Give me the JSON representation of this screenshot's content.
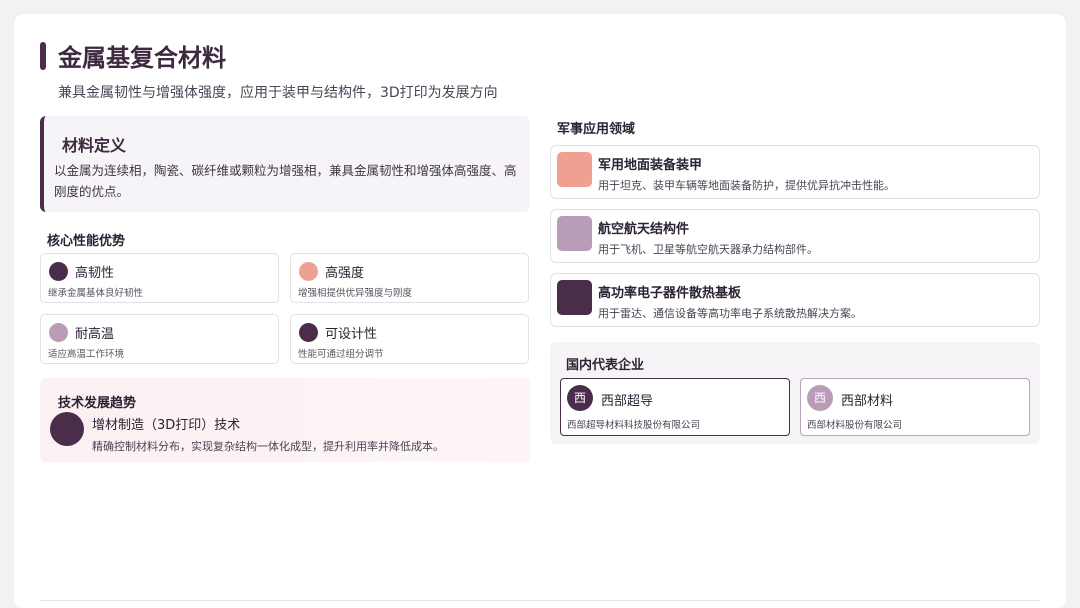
{
  "slide": {
    "title": "金属基复合材料",
    "subtitle": "兼具金属韧性与增强体强度，应用于装甲与结构件，3D打印为发展方向"
  },
  "definition": {
    "title": "材料定义",
    "text": "以金属为连续相，陶瓷、碳纤维或颗粒为增强相，兼具金属韧性和增强体高强度、高刚度的优点。"
  },
  "advantages": {
    "label": "核心性能优势",
    "items": [
      {
        "name": "高韧性",
        "desc": "继承金属基体良好韧性",
        "color": "#4a2d4a"
      },
      {
        "name": "高强度",
        "desc": "增强相提供优异强度与刚度",
        "color": "#f0a091"
      },
      {
        "name": "耐高温",
        "desc": "适应高温工作环境",
        "color": "#b89cb8"
      },
      {
        "name": "可设计性",
        "desc": "性能可通过组分调节",
        "color": "#4a2d4a"
      }
    ]
  },
  "trend": {
    "label": "技术发展趋势",
    "name": "增材制造（3D打印）技术",
    "desc": "精确控制材料分布，实现复杂结构一体化成型，提升利用率并降低成本。"
  },
  "military": {
    "label": "军事应用领域",
    "items": [
      {
        "name": "军用地面装备装甲",
        "desc": "用于坦克、装甲车辆等地面装备防护，提供优异抗冲击性能。",
        "color": "#f0a091"
      },
      {
        "name": "航空航天结构件",
        "desc": "用于飞机、卫星等航空航天器承力结构部件。",
        "color": "#b89cb8"
      },
      {
        "name": "高功率电子器件散热基板",
        "desc": "用于雷达、通信设备等高功率电子系统散热解决方案。",
        "color": "#4a2d4a"
      }
    ]
  },
  "companies": {
    "label": "国内代表企业",
    "items": [
      {
        "badge": "西",
        "name": "西部超导",
        "full": "西部超导材料科技股份有限公司",
        "color": "#4a2d4a"
      },
      {
        "badge": "西",
        "name": "西部材料",
        "full": "西部材料股份有限公司",
        "color": "#b89cb8"
      }
    ]
  }
}
